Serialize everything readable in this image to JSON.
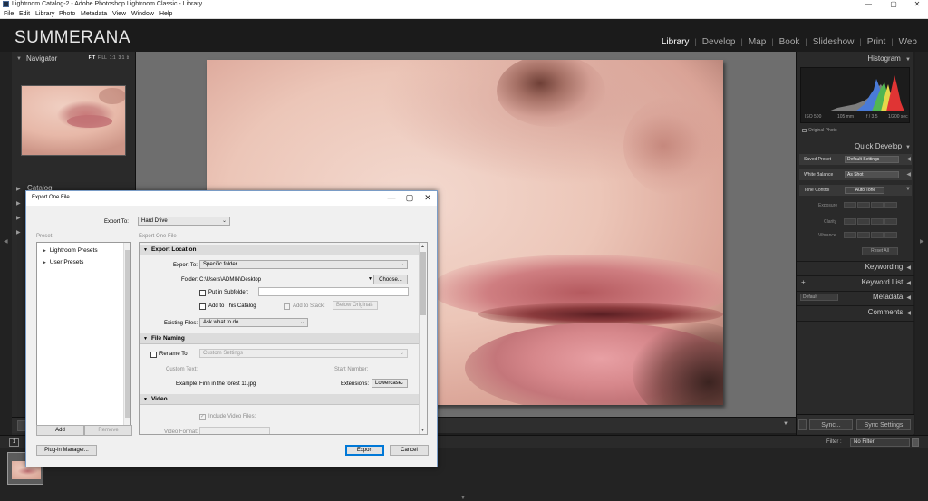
{
  "window": {
    "title": "Lightroom Catalog-2 - Adobe Photoshop Lightroom Classic - Library",
    "minimize": "—",
    "maximize": "▢",
    "close": "✕"
  },
  "menu": [
    "File",
    "Edit",
    "Library",
    "Photo",
    "Metadata",
    "View",
    "Window",
    "Help"
  ],
  "brand": "SUMMERANA",
  "modules": [
    {
      "label": "Library",
      "active": true
    },
    {
      "label": "Develop"
    },
    {
      "label": "Map"
    },
    {
      "label": "Book"
    },
    {
      "label": "Slideshow"
    },
    {
      "label": "Print"
    },
    {
      "label": "Web"
    }
  ],
  "module_separator": "|",
  "left_panel": {
    "navigator": "Navigator",
    "nav_modes": [
      "FIT",
      "FILL",
      "1:1",
      "3:1"
    ],
    "catalog": "Catalog"
  },
  "right_panel": {
    "histogram": "Histogram",
    "histo_meta": [
      "ISO 500",
      "105 mm",
      "f / 3.5",
      "1/200 sec"
    ],
    "original_photo": "Original Photo",
    "quick_develop": "Quick Develop",
    "saved_preset_label": "Saved Preset",
    "saved_preset_value": "Default Settings",
    "white_balance_label": "White Balance",
    "white_balance_value": "As Shot",
    "tone_control_label": "Tone Control",
    "auto_tone": "Auto Tone",
    "exposure": "Exposure",
    "clarity": "Clarity",
    "vibrance": "Vibrance",
    "reset_all": "Reset All",
    "keywording": "Keywording",
    "keyword_list": "Keyword List",
    "keyword_plus": "+",
    "metadata": "Metadata",
    "metadata_preset": "Default",
    "comments": "Comments",
    "sync": "Sync...",
    "sync_settings": "Sync Settings"
  },
  "filmstrip": {
    "page_num": "1",
    "filter_label": "Filter :",
    "filter_value": "No Filter"
  },
  "dialog": {
    "title": "Export One File",
    "export_to_label": "Export To:",
    "export_to_value": "Hard Drive",
    "preset_label": "Preset:",
    "subtitle": "Export One File",
    "presets": [
      "Lightroom Presets",
      "User Presets"
    ],
    "add": "Add",
    "remove": "Remove",
    "plugin_manager": "Plug-in Manager...",
    "export": "Export",
    "cancel": "Cancel",
    "export_location": {
      "header": "Export Location",
      "export_to_label": "Export To:",
      "export_to_value": "Specific folder",
      "folder_label": "Folder:",
      "folder_value": "C:\\Users\\ADMIN\\Desktop",
      "choose": "Choose...",
      "put_in_subfolder": "Put in Subfolder:",
      "add_to_catalog": "Add to This Catalog",
      "add_to_stack": "Add to Stack:",
      "below_original": "Below Original",
      "existing_files_label": "Existing Files:",
      "existing_files_value": "Ask what to do"
    },
    "file_naming": {
      "header": "File Naming",
      "rename_to": "Rename To:",
      "rename_value": "Custom Settings",
      "custom_text": "Custom Text:",
      "start_number": "Start Number:",
      "example_label": "Example:",
      "example_value": "Finn in the forest 11.jpg",
      "extensions_label": "Extensions:",
      "extensions_value": "Lowercase"
    },
    "video": {
      "header": "Video",
      "include_video": "Include Video Files:",
      "video_format": "Video Format:"
    }
  },
  "colors": {
    "accent_blue": "#0078d7",
    "lr_panel": "#2a2a2a",
    "lr_bg": "#1f1f1f"
  }
}
